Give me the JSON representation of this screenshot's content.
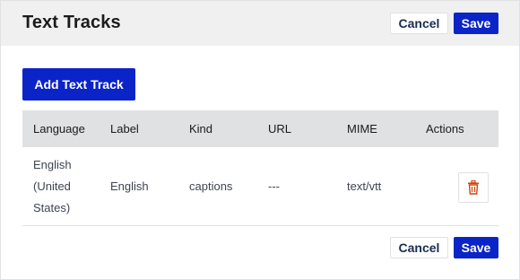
{
  "header": {
    "title": "Text Tracks",
    "cancel_label": "Cancel",
    "save_label": "Save"
  },
  "toolbar": {
    "add_label": "Add Text Track"
  },
  "table": {
    "columns": [
      "Language",
      "Label",
      "Kind",
      "URL",
      "MIME",
      "Actions"
    ],
    "rows": [
      {
        "language_lines": [
          "English",
          "(United",
          "States)"
        ],
        "label": "English",
        "kind": "captions",
        "url": "---",
        "mime": "text/vtt",
        "action_icon": "trash-icon"
      }
    ]
  },
  "footer": {
    "cancel_label": "Cancel",
    "save_label": "Save"
  },
  "colors": {
    "primary": "#0b24c7",
    "header_bg": "#f0f0f0",
    "table_header_bg": "#dfe1e2",
    "delete_icon": "#d54309"
  }
}
